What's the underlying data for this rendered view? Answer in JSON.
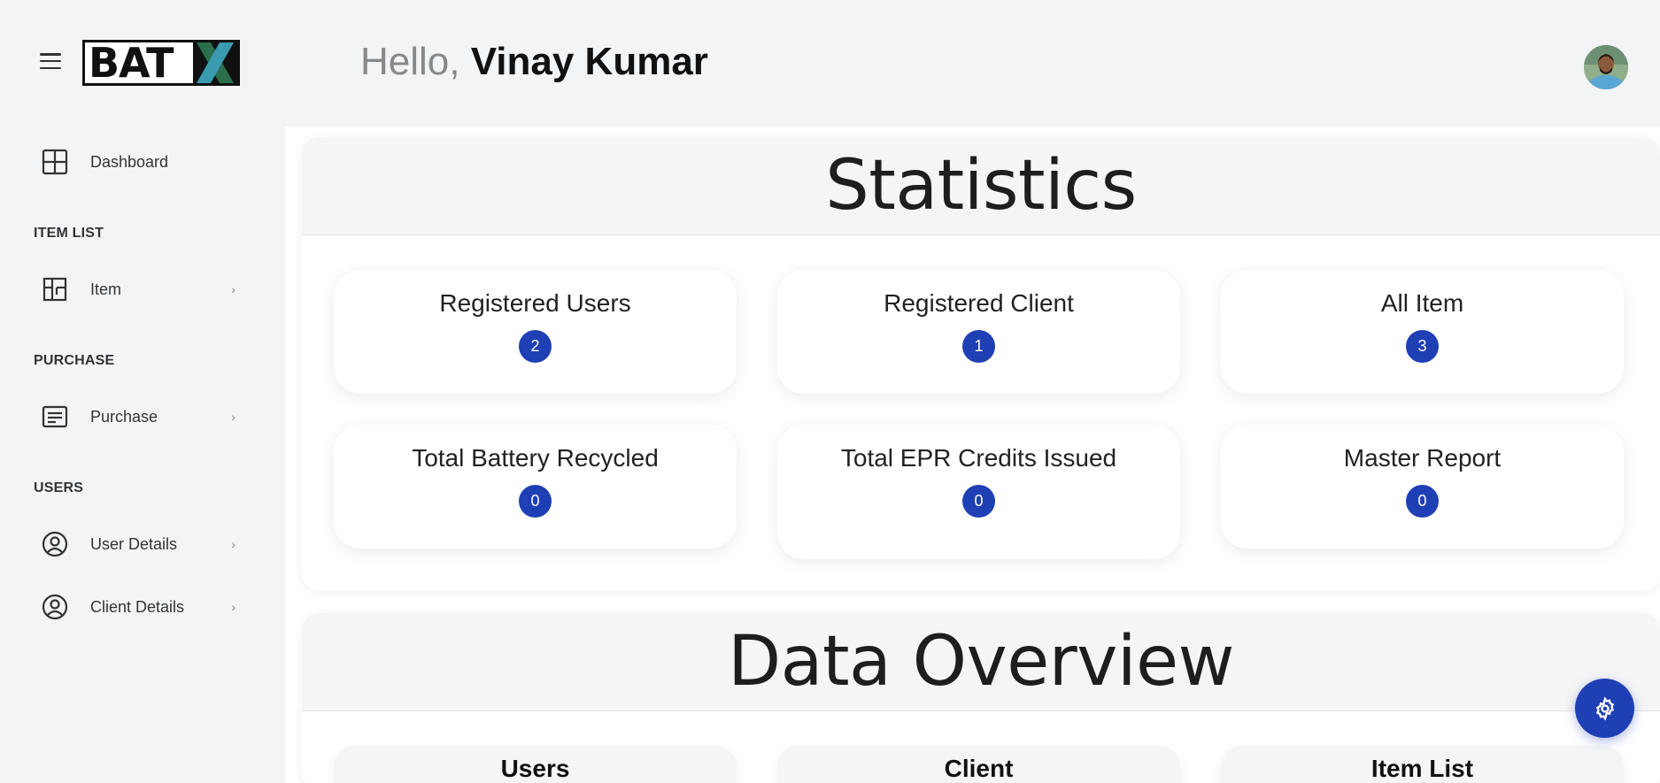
{
  "app": {
    "logo_text": "BAT",
    "brand_color": "#1f3fb5"
  },
  "header": {
    "greeting": "Hello, ",
    "user_name": "Vinay Kumar"
  },
  "sidebar": {
    "dashboard": {
      "label": "Dashboard",
      "icon": "grid-icon"
    },
    "sections": [
      {
        "title": "ITEM LIST",
        "items": [
          {
            "label": "Item",
            "icon": "layout-icon"
          }
        ]
      },
      {
        "title": "PURCHASE",
        "items": [
          {
            "label": "Purchase",
            "icon": "document-icon"
          }
        ]
      },
      {
        "title": "USERS",
        "items": [
          {
            "label": "User Details",
            "icon": "user-circle-icon"
          },
          {
            "label": "Client Details",
            "icon": "user-circle-icon"
          }
        ]
      }
    ]
  },
  "statistics": {
    "title": "Statistics",
    "cards": [
      {
        "label": "Registered Users",
        "value": "2"
      },
      {
        "label": "Registered Client",
        "value": "1"
      },
      {
        "label": "All Item",
        "value": "3"
      },
      {
        "label": "Total Battery Recycled",
        "value": "0"
      },
      {
        "label": "Total EPR Credits Issued",
        "value": "0"
      },
      {
        "label": "Master Report",
        "value": "0"
      }
    ]
  },
  "overview": {
    "title": "Data Overview",
    "cards": [
      {
        "label": "Users"
      },
      {
        "label": "Client"
      },
      {
        "label": "Item List"
      }
    ]
  },
  "fab": {
    "icon": "settings-gear-icon"
  }
}
